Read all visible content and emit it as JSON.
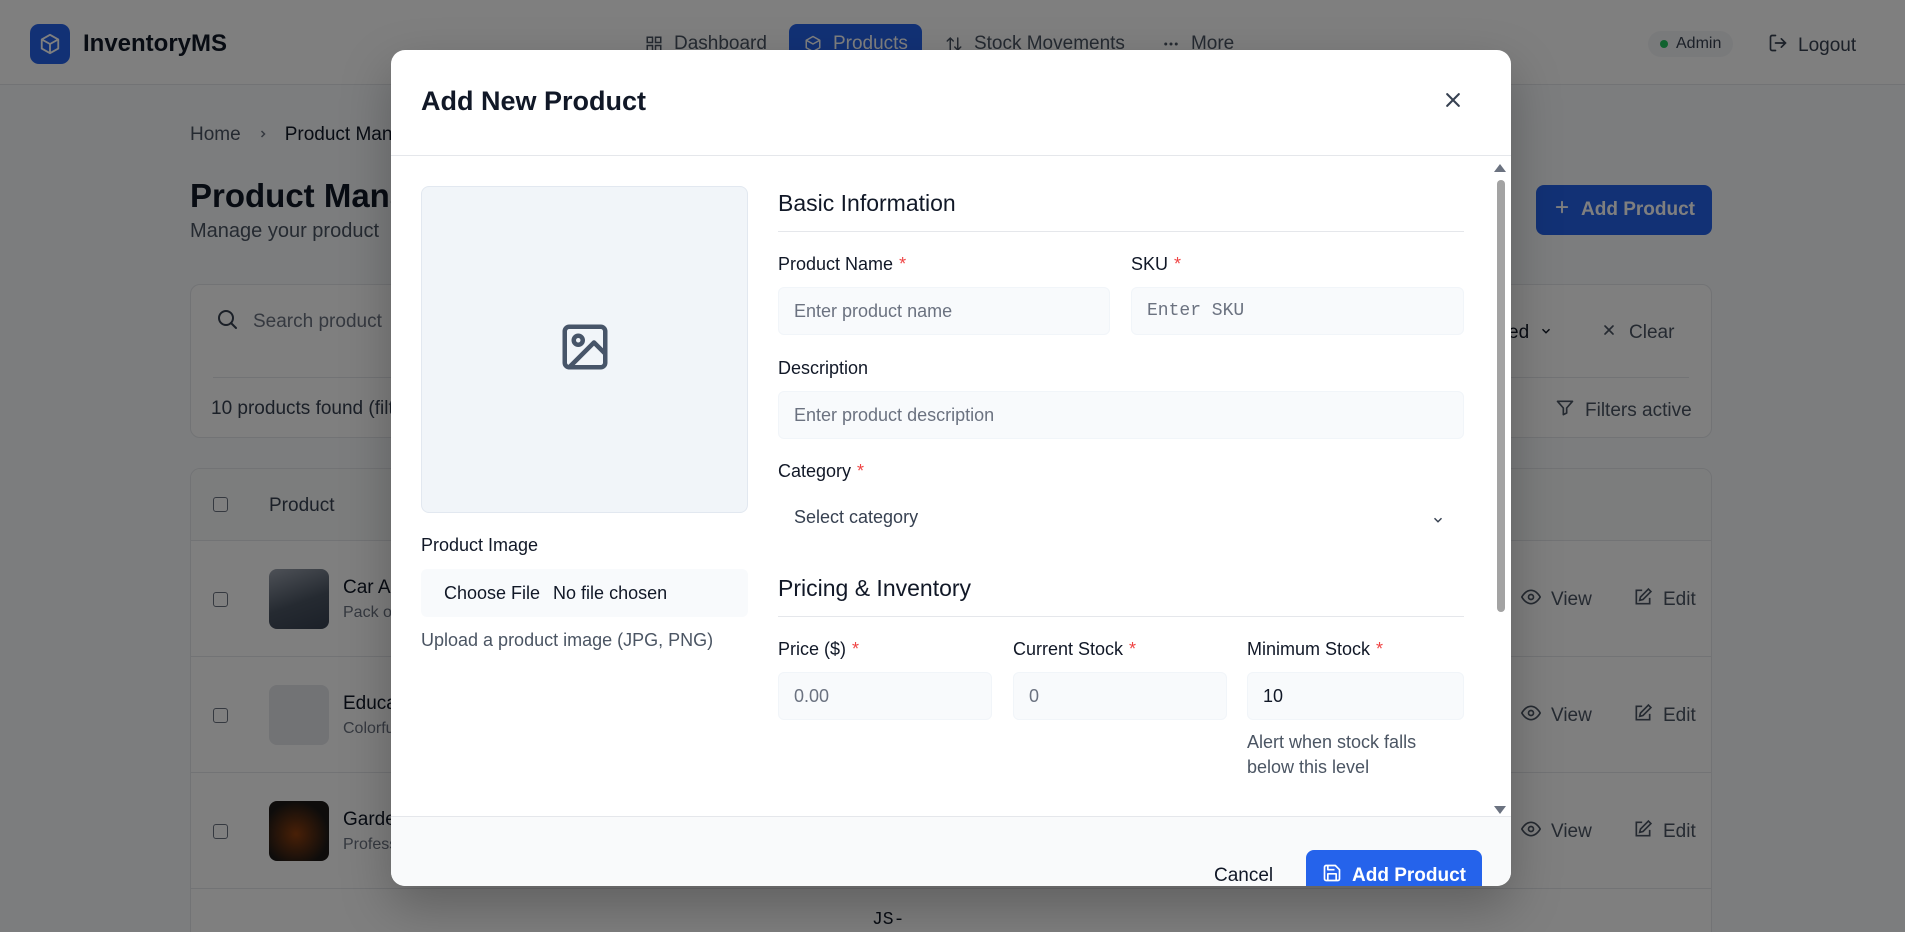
{
  "app": {
    "name": "InventoryMS"
  },
  "nav": [
    {
      "label": "Dashboard",
      "icon": "dashboard-icon"
    },
    {
      "label": "Products",
      "icon": "box-icon",
      "active": true
    },
    {
      "label": "Stock Movements",
      "icon": "arrows-updown-icon"
    },
    {
      "label": "More",
      "icon": "more-icon"
    }
  ],
  "header": {
    "admin_badge": "Admin",
    "logout_label": "Logout"
  },
  "breadcrumb": {
    "home": "Home",
    "current": "Product Man"
  },
  "page": {
    "title": "Product Mana",
    "subtitle": "Manage your product",
    "add_button": "Add Product"
  },
  "filters": {
    "search_placeholder": "Search product",
    "sort_fragment": "ed",
    "clear_label": "Clear",
    "found_text": "10 products found (filt",
    "filters_active": "Filters active"
  },
  "table": {
    "column_product": "Product",
    "rows": [
      {
        "name": "Car A",
        "desc": "Pack o",
        "view": "View",
        "edit": "Edit"
      },
      {
        "name": "Educa",
        "desc": "Colorfu",
        "view": "View",
        "edit": "Edit"
      },
      {
        "name": "Garde",
        "desc": "Profess",
        "view": "View",
        "edit": "Edit"
      }
    ],
    "bottom_fragment": "JS-"
  },
  "modal": {
    "title": "Add New Product",
    "image": {
      "label": "Product Image",
      "choose_file": "Choose File",
      "no_file": "No file chosen",
      "hint": "Upload a product image (JPG, PNG)"
    },
    "basic": {
      "title": "Basic Information",
      "product_name": {
        "label": "Product Name",
        "placeholder": "Enter product name"
      },
      "sku": {
        "label": "SKU",
        "placeholder": "Enter SKU"
      },
      "description": {
        "label": "Description",
        "placeholder": "Enter product description"
      },
      "category": {
        "label": "Category",
        "selected": "Select category"
      }
    },
    "pricing": {
      "title": "Pricing & Inventory",
      "price": {
        "label": "Price ($)",
        "placeholder": "0.00"
      },
      "current_stock": {
        "label": "Current Stock",
        "placeholder": "0"
      },
      "minimum_stock": {
        "label": "Minimum Stock",
        "value": "10",
        "help": "Alert when stock falls below this level"
      }
    },
    "footer": {
      "cancel": "Cancel",
      "submit": "Add Product"
    }
  },
  "colors": {
    "primary": "#2563eb",
    "required": "#ef4444",
    "status_online": "#22c55e"
  }
}
